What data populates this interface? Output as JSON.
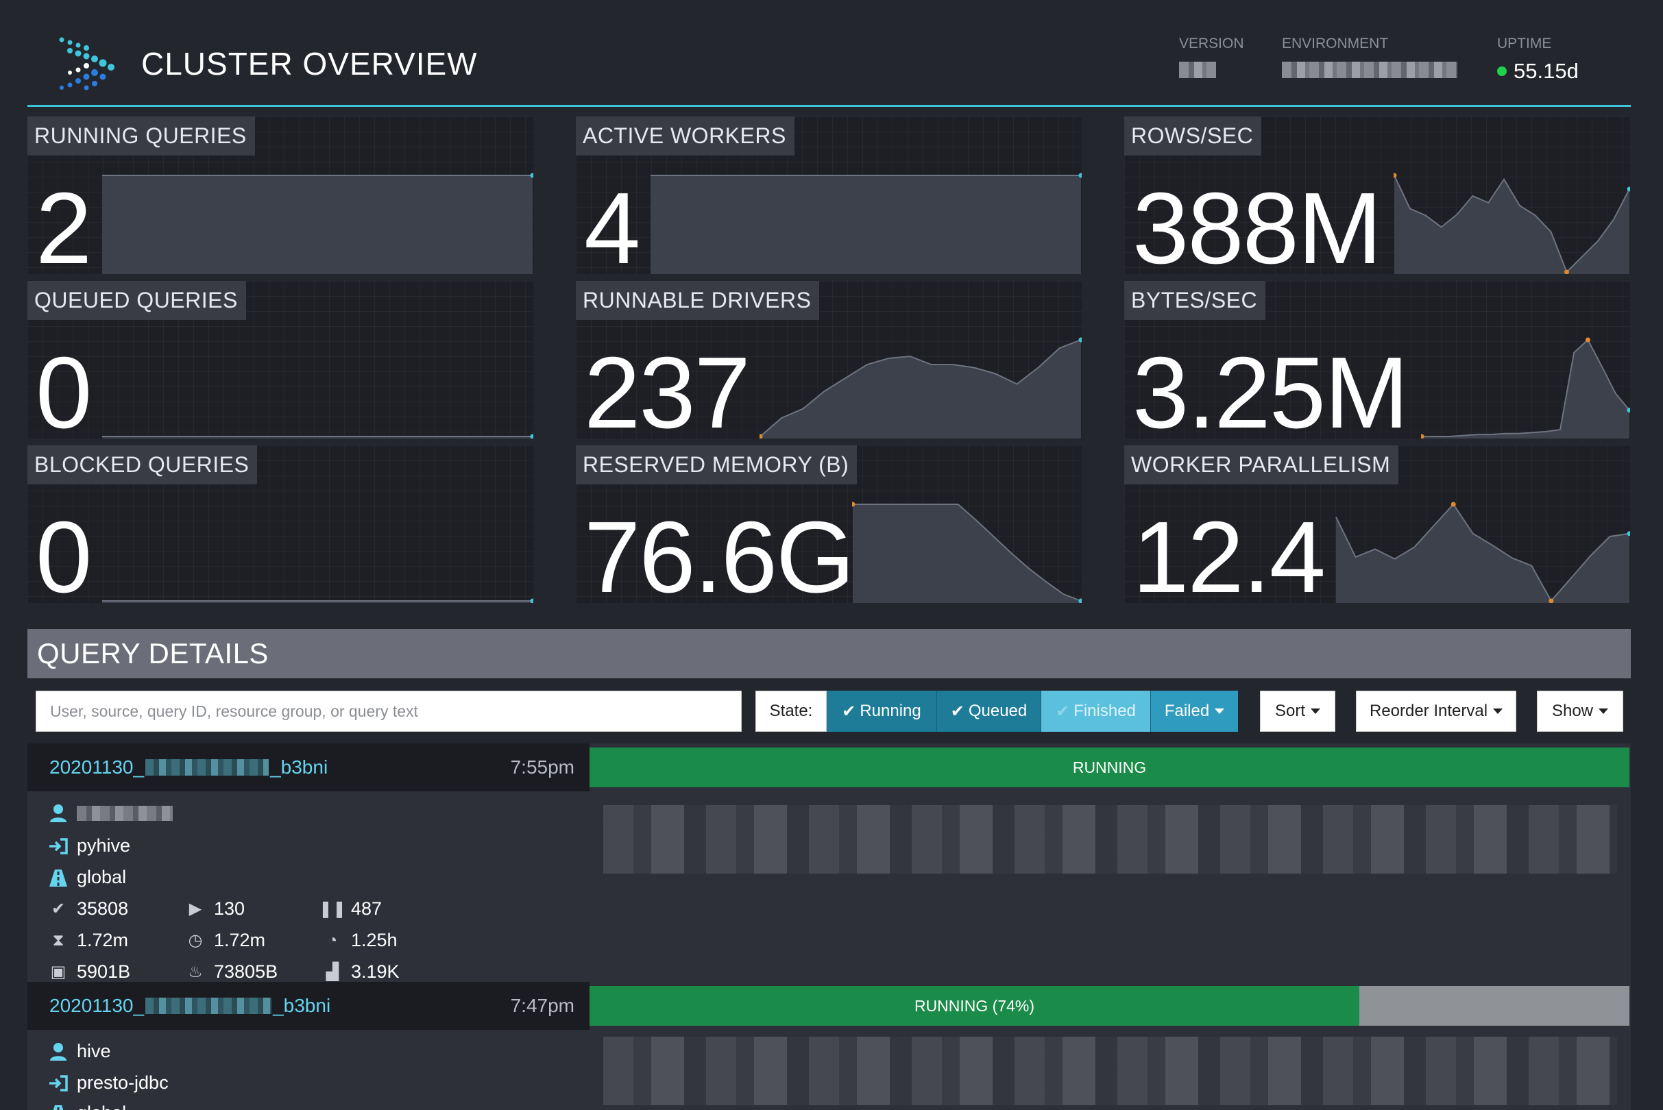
{
  "header": {
    "title": "CLUSTER OVERVIEW",
    "version_label": "VERSION",
    "environment_label": "ENVIRONMENT",
    "uptime_label": "UPTIME",
    "uptime_value": "55.15d",
    "uptime_status_color": "#1ed04a",
    "accent_color": "#3fc6dc"
  },
  "tiles": {
    "running_queries": {
      "label": "RUNNING QUERIES",
      "value": "2"
    },
    "active_workers": {
      "label": "ACTIVE WORKERS",
      "value": "4"
    },
    "rows_per_sec": {
      "label": "ROWS/SEC",
      "value": "388M"
    },
    "queued_queries": {
      "label": "QUEUED QUERIES",
      "value": "0"
    },
    "runnable_drivers": {
      "label": "RUNNABLE DRIVERS",
      "value": "237"
    },
    "bytes_per_sec": {
      "label": "BYTES/SEC",
      "value": "3.25M"
    },
    "blocked_queries": {
      "label": "BLOCKED QUERIES",
      "value": "0"
    },
    "reserved_memory": {
      "label": "RESERVED MEMORY (B)",
      "value": "76.6G"
    },
    "worker_parallelism": {
      "label": "WORKER PARALLELISM",
      "value": "12.4"
    }
  },
  "sparklines": {
    "running_queries": [
      2,
      2,
      2,
      2,
      2,
      2,
      2,
      2,
      2,
      2,
      2,
      2,
      2,
      2,
      2,
      2
    ],
    "active_workers": [
      4,
      4,
      4,
      4,
      4,
      4,
      4,
      4,
      4,
      4,
      4,
      4,
      4,
      4,
      4,
      4
    ],
    "rows_per_sec": [
      100,
      66,
      59,
      47,
      60,
      79,
      72,
      96,
      69,
      59,
      42,
      1,
      17,
      33,
      55,
      86
    ],
    "queued_queries": [
      0,
      0,
      0,
      0,
      0,
      0,
      0,
      0,
      0,
      0,
      0,
      0,
      0,
      0,
      0,
      0
    ],
    "runnable_drivers": [
      0,
      18,
      27,
      44,
      57,
      70,
      76,
      78,
      70,
      70,
      67,
      61,
      51,
      67,
      86,
      94
    ],
    "bytes_per_sec": [
      1,
      1,
      1,
      2,
      3,
      3,
      4,
      4,
      5,
      6,
      8,
      87,
      100,
      73,
      45,
      28
    ],
    "blocked_queries": [
      0,
      0,
      0,
      0,
      0,
      0,
      0,
      0,
      0,
      0,
      0,
      0,
      0,
      0,
      0,
      0
    ],
    "reserved_memory": [
      100,
      100,
      100,
      100,
      100,
      100,
      100,
      84,
      67,
      50,
      34,
      20,
      7,
      0
    ],
    "worker_parallelism": [
      87,
      46,
      54,
      44,
      56,
      78,
      100,
      70,
      58,
      45,
      37,
      1,
      24,
      47,
      67,
      70
    ]
  },
  "query_details": {
    "title": "QUERY DETAILS",
    "search_placeholder": "User, source, query ID, resource group, or query text",
    "state_label": "State:",
    "filters": {
      "running": "Running",
      "queued": "Queued",
      "finished": "Finished",
      "failed": "Failed"
    },
    "sort_label": "Sort",
    "reorder_label": "Reorder Interval",
    "show_label": "Show"
  },
  "queries": [
    {
      "id_prefix": "20201130_",
      "id_suffix": "_b3bni",
      "time": "7:55pm",
      "state": "RUNNING",
      "progress": 1.0,
      "source": "pyhive",
      "resource_group": "global",
      "completed_splits": "35808",
      "running_splits": "130",
      "queued_splits": "487",
      "wall_time": "1.72m",
      "elapsed_time": "1.72m",
      "cpu_time": "1.25h",
      "current_memory": "5901B",
      "peak_memory": "73805B",
      "cumulative_memory": "3.19K"
    },
    {
      "id_prefix": "20201130_",
      "id_suffix": "_b3bni",
      "time": "7:47pm",
      "state": "RUNNING (74%)",
      "progress": 0.74,
      "user": "hive",
      "source": "presto-jdbc",
      "resource_group": "global"
    }
  ]
}
